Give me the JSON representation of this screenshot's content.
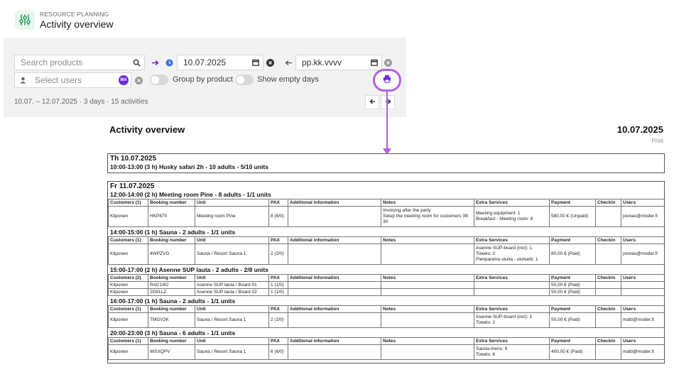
{
  "header": {
    "kicker": "RESOURCE PLANNING",
    "title": "Activity overview"
  },
  "filters": {
    "search_placeholder": "Search products",
    "from_date": "10.07.2025",
    "to_date_placeholder": "pp.kk.vvvv",
    "users_placeholder": "Select users",
    "user_avatar": "MA",
    "group_by_product_label": "Group by product",
    "show_empty_days_label": "Show empty days",
    "summary": "10.07. – 12.07.2025 · 3 days · 15 activities"
  },
  "colors": {
    "accent": "#b45ee0",
    "brand_green": "#2e9d63",
    "avatar": "#6c2bd9",
    "blue_clock": "#3b6fd8"
  },
  "document": {
    "title": "Activity overview",
    "date": "10.07.2025",
    "print_label": "Print",
    "columns": [
      "Booking number",
      "Unit",
      "PAX",
      "Additional information",
      "Notes",
      "Extra Services",
      "Payment",
      "Checkin",
      "Users"
    ],
    "days": [
      {
        "heading": "Th 10.07.2025",
        "activities": [
          {
            "title": "10:00-13:00 (3 h) Husky safari 2h - 10 adults - 5/10 units",
            "customers_label": "",
            "rows": []
          }
        ]
      },
      {
        "heading": "Fr 11.07.2025",
        "activities": [
          {
            "title": "12:00-14:00 (2 h) Meeting room Pine - 8 adults - 1/1 units",
            "customers_label": "Customers (1)",
            "rows": [
              {
                "customer": "Kilponen",
                "booking": "HKP870",
                "unit": "Meeting room Pine",
                "pax": "8 (8/0)",
                "info": "",
                "notes": [
                  "Invoicing after the party",
                  "Setup the meeting room for customers 08:",
                  "30"
                ],
                "extras": [
                  "Meeting equipment: 1",
                  "Breakfast - Meeting room: 8"
                ],
                "payment": "580,00 € (Unpaid)",
                "checkin": "",
                "users": "joonas@moder.fi"
              }
            ]
          },
          {
            "title": "14:00-15:00 (1 h) Sauna - 2 adults - 1/1 units",
            "customers_label": "Customers (1)",
            "rows": [
              {
                "customer": "Kilponen",
                "booking": "4WPZVG",
                "unit": "Sauna / Resort Sauna 1",
                "pax": "2 (2/0)",
                "info": "",
                "notes": [],
                "extras": [
                  "Asenne SUP-board (incl): 1",
                  "Towels: 2",
                  "Pienpanimo-oluita - olutsetti: 1"
                ],
                "payment": "80,00 € (Paid)",
                "checkin": "",
                "users": "joonas@moder.fi"
              }
            ]
          },
          {
            "title": "15:00-17:00 (2 h) Asenne SUP lauta - 2 adults - 2/8 units",
            "customers_label": "Customers (2)",
            "rows": [
              {
                "customer": "Kilponen",
                "booking": "RAC19O",
                "unit": "Asenne SUP lauta / Board 01",
                "pax": "1 (1/0)",
                "info": "",
                "notes": [],
                "extras": [],
                "payment": "50,00 € (Paid)",
                "checkin": "",
                "users": ""
              },
              {
                "customer": "Kilponen",
                "booking": "2D91LZ",
                "unit": "Asenne SUP lauta / Board 02",
                "pax": "1 (1/0)",
                "info": "",
                "notes": [],
                "extras": [],
                "payment": "50,00 € (Paid)",
                "checkin": "",
                "users": ""
              }
            ]
          },
          {
            "title": "16:00-17:00 (1 h) Sauna - 2 adults - 1/1 units",
            "customers_label": "Customers (1)",
            "rows": [
              {
                "customer": "Kilponen",
                "booking": "TMGV2K",
                "unit": "Sauna / Resort Sauna 1",
                "pax": "2 (2/0)",
                "info": "",
                "notes": [],
                "extras": [
                  "Asenne SUP-board (incl): 1",
                  "Towels: 2"
                ],
                "payment": "50,00 € (Paid)",
                "checkin": "",
                "users": "matti@moder.fi"
              }
            ]
          },
          {
            "title": "20:00-23:00 (3 h) Sauna - 6 adults - 1/1 units",
            "customers_label": "Customers (1)",
            "rows": [
              {
                "customer": "Kilponen",
                "booking": "WSXQPV",
                "unit": "Sauna / Resort Sauna 1",
                "pax": "6 (6/0)",
                "info": "",
                "notes": [],
                "extras": [
                  "Sauna-menu: 6",
                  "Towels: 6"
                ],
                "payment": "400,00 € (Paid)",
                "checkin": "",
                "users": "matti@moder.fi"
              }
            ]
          }
        ]
      }
    ]
  }
}
